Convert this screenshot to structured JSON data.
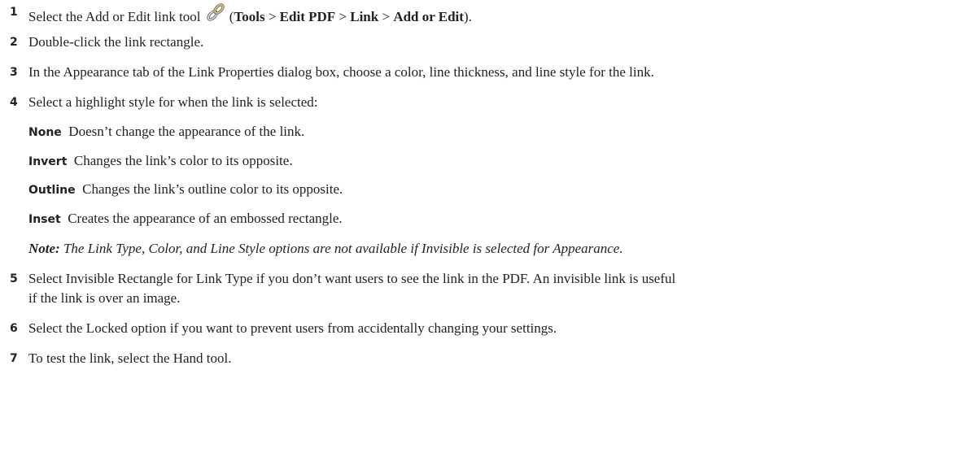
{
  "steps": [
    {
      "number": "1",
      "text_before_icon": "Select the Add or Edit link tool",
      "icon": "chain-link-icon",
      "path_open": "(",
      "path": [
        {
          "label": "Tools",
          "bold": true
        },
        {
          "label": " > ",
          "bold": false
        },
        {
          "label": "Edit PDF",
          "bold": true
        },
        {
          "label": " > ",
          "bold": false
        },
        {
          "label": "Link",
          "bold": true
        },
        {
          "label": " > ",
          "bold": false
        },
        {
          "label": "Add or Edit",
          "bold": true
        }
      ],
      "path_close": ")."
    },
    {
      "number": "2",
      "text": "Double-click the link rectangle."
    },
    {
      "number": "3",
      "text": "In the Appearance tab of the Link Properties dialog box, choose a color, line thickness, and line style for the link."
    },
    {
      "number": "4",
      "text": "Select a highlight style for when the link is selected:"
    },
    {
      "number": "5",
      "text_line1": "Select Invisible Rectangle for Link Type if you don’t want users to see the link in the PDF. An invisible link is useful",
      "text_line2": "if the link is over an image."
    },
    {
      "number": "6",
      "text": "Select the Locked option if you want to prevent users from accidentally changing your settings."
    },
    {
      "number": "7",
      "text": "To test the link, select the Hand tool."
    }
  ],
  "highlight_styles": [
    {
      "term": "None",
      "description": "Doesn’t change the appearance of the link."
    },
    {
      "term": "Invert",
      "description": "Changes the link’s color to its opposite."
    },
    {
      "term": "Outline",
      "description": "Changes the link’s outline color to its opposite."
    },
    {
      "term": "Inset",
      "description": "Creates the appearance of an embossed rectangle."
    }
  ],
  "note": {
    "label": "Note:",
    "text": "The Link Type, Color, and Line Style options are not available if Invisible is selected for Appearance."
  }
}
